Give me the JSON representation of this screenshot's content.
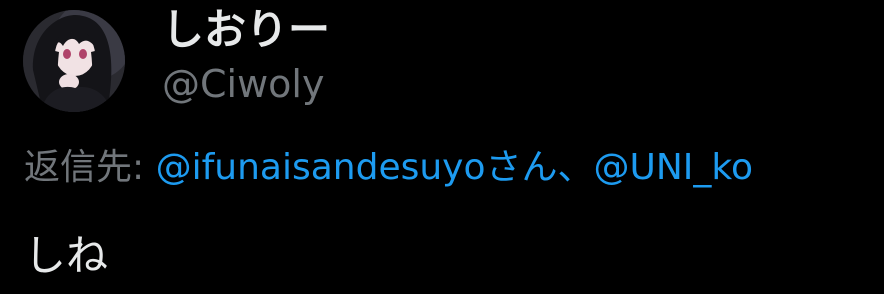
{
  "tweet": {
    "author": {
      "display_name": "しおりー",
      "handle": "@Ciwoly",
      "avatar_icon": "anime-girl-avatar"
    },
    "reply_to": {
      "prefix": "返信先:",
      "mention_1": "@ifunaisandesuyo",
      "suffix_1": "さん、",
      "mention_2": "@UNI_ko"
    },
    "text": "しね"
  },
  "colors": {
    "background": "#000000",
    "primary_text": "#e7e9ea",
    "secondary_text": "#71767b",
    "link": "#1d9bf0"
  }
}
